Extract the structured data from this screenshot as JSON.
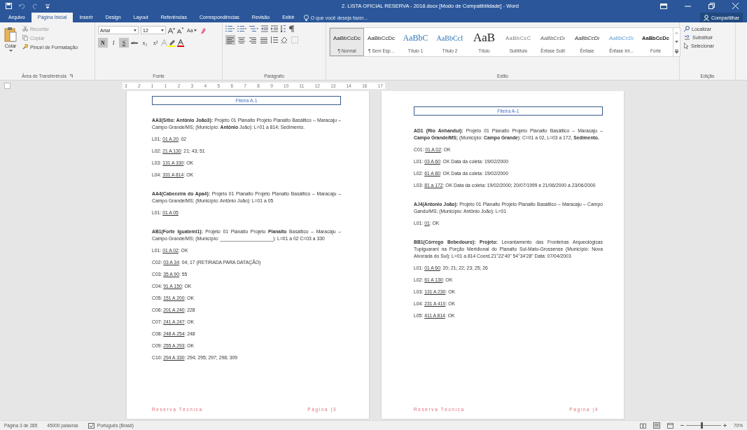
{
  "title_bar": {
    "title": "2. LISTA OFICIAL RESERVA - 2018.docx [Modo de Compatibilidade] - Word"
  },
  "tabs": [
    {
      "label": "Arquivo",
      "selected": false
    },
    {
      "label": "Página Inicial",
      "selected": true
    },
    {
      "label": "Inserir",
      "selected": false
    },
    {
      "label": "Design",
      "selected": false
    },
    {
      "label": "Layout",
      "selected": false
    },
    {
      "label": "Referências",
      "selected": false
    },
    {
      "label": "Correspondências",
      "selected": false
    },
    {
      "label": "Revisão",
      "selected": false
    },
    {
      "label": "Exibir",
      "selected": false
    }
  ],
  "tell_me": {
    "placeholder": "O que você deseja fazer..."
  },
  "share_button": "Compartilhar",
  "ribbon": {
    "clipboard": {
      "paste": "Colar",
      "cut": "Recortar",
      "copy": "Copiar",
      "format_painter": "Pincel de Formatação",
      "label": "Área de Transferência"
    },
    "font": {
      "font_name": "Arial",
      "font_size": "12",
      "change_case": "Aa",
      "format_buttons": [
        {
          "label": "N",
          "on": true
        },
        {
          "label": "I",
          "on": false
        },
        {
          "label": "S",
          "on": true
        },
        {
          "label": "abc",
          "on": false
        },
        {
          "label": "x₂",
          "on": false
        },
        {
          "label": "x²",
          "on": false
        }
      ],
      "label": "Fonte"
    },
    "paragraph": {
      "align_buttons": [
        {
          "selected": true
        },
        {
          "selected": false
        },
        {
          "selected": false
        },
        {
          "selected": false
        }
      ],
      "label": "Parágrafo"
    },
    "styles": {
      "items": [
        {
          "sample": "AaBbCcDc",
          "name": "¶ Normal",
          "kind": "normal",
          "selected": true
        },
        {
          "sample": "AaBbCcDc",
          "name": "¶ Sem Esp...",
          "kind": "normal",
          "selected": false
        },
        {
          "sample": "AaBbC",
          "name": "Título 1",
          "kind": "heading1",
          "selected": false
        },
        {
          "sample": "AaBbCcI",
          "name": "Título 2",
          "kind": "heading2",
          "selected": false
        },
        {
          "sample": "AaB",
          "name": "Título",
          "kind": "title",
          "selected": false
        },
        {
          "sample": "AaBbCcC",
          "name": "Subtítulo",
          "kind": "subtitle",
          "selected": false
        },
        {
          "sample": "AaBbCcDı",
          "name": "Ênfase Sutil",
          "kind": "subtle",
          "selected": false
        },
        {
          "sample": "AaBbCcDı",
          "name": "Ênfase",
          "kind": "emphasis",
          "selected": false
        },
        {
          "sample": "AaBbCcDı",
          "name": "Ênfase Int...",
          "kind": "intense",
          "selected": false
        },
        {
          "sample": "AaBbCcDc",
          "name": "Forte",
          "kind": "strong",
          "selected": false
        }
      ],
      "label": "Estilo"
    },
    "editing": {
      "find": "Localizar",
      "replace": "Substituir",
      "select": "Selecionar",
      "label": "Edição"
    }
  },
  "ruler": {
    "numbers": [
      "3",
      "2",
      "1",
      "1",
      "2",
      "3",
      "4",
      "5",
      "6",
      "7",
      "8",
      "9",
      "10",
      "11",
      "12",
      "13",
      "14",
      "16",
      "17"
    ]
  },
  "pages": [
    {
      "header": "Fileira A.1",
      "blocks": [
        {
          "kind": "heading",
          "text": "**AA3(Sítio: Antônio João3):** Projeto 01 Planalto Projeto Planalto Basáltico – Maracaju – Campo Grande/MS; (Município: **Antônio** João): L=01 a 814; Sedimento."
        },
        {
          "kind": "line",
          "label": "L01:",
          "range": "01 A 20",
          "rest": ": 02"
        },
        {
          "kind": "line",
          "label": "L02:",
          "range": "21 A 130",
          "rest": ": 21; 43; 51"
        },
        {
          "kind": "line",
          "label": "L03:",
          "range": "131 A 330",
          "rest": ": OK"
        },
        {
          "kind": "line",
          "label": "L04:",
          "range": "331 A 814",
          "rest": ": OK"
        },
        {
          "kind": "heading",
          "text": "**AA4(Cabeceira do Apa4):** Projeto 01 Planalto Projeto Planalto Basáltico – Maracaju – Campo Grande/MS; (Município: Antônio João): L=01 a 05"
        },
        {
          "kind": "line",
          "label": "L01:",
          "range": "01 A 05"
        },
        {
          "kind": "heading",
          "text": "**AB1(Forte Iguatemi1):** Projeto 01 Planalto Projeto **Planalto** Basáltico – Maracaju – Campo Grande/MS; (Município: ____________________): L=01 a 02 C=03 a 330"
        },
        {
          "kind": "line",
          "label": "L01:",
          "range": "01 A 02",
          "rest": ": OK"
        },
        {
          "kind": "line",
          "label": "C02:",
          "range": "03 A 34",
          "rest": ": 04; 17 (RETIRADA PARA DATAÇÃO)"
        },
        {
          "kind": "line",
          "label": "C03:",
          "range": "35 A 90",
          "rest": ": 55"
        },
        {
          "kind": "line",
          "label": "C04:",
          "range": "91 A 150",
          "rest": ": OK"
        },
        {
          "kind": "line",
          "label": "C05:",
          "range": "151 A 200",
          "rest": ": OK"
        },
        {
          "kind": "line",
          "label": "C06:",
          "range": "201 A 240",
          "rest": ": 228"
        },
        {
          "kind": "line",
          "label": "C07:",
          "range": "241 A 247",
          "rest": ": OK"
        },
        {
          "kind": "line",
          "label": "C08:",
          "range": "248 A 254",
          "rest": ": 248"
        },
        {
          "kind": "line",
          "label": "C09:",
          "range": "255 A 293",
          "rest": ": OK"
        },
        {
          "kind": "line",
          "label": "C10:",
          "range": "294 A 330",
          "rest": ": 294; 295; 297; 298; 309"
        }
      ],
      "footer_left": "Reserva Técnica",
      "footer_right": "Página |3"
    },
    {
      "header": "Fileira A-1",
      "blocks": [
        {
          "kind": "heading",
          "text": "**AD1 (Rio Anhanduí):** Projeto 01 Planalto Projeto Planalto Basáltico – Maracaju – **Campo Grande/MS;** (Município: **Campo Grande**): C=01 a 02, L=03 a 172, **Sedimento.**"
        },
        {
          "kind": "line",
          "label": "C01:",
          "range": "01 A 02",
          "rest": ": OK"
        },
        {
          "kind": "line",
          "label": "L01:",
          "range": "03 A 60",
          "rest": ": OK Data da coleta: 19/02/2000"
        },
        {
          "kind": "line",
          "label": "L02:",
          "range": "61 A 80",
          "rest": ": OK Data da coleta: 19/02/2000"
        },
        {
          "kind": "line",
          "label": "L03:",
          "range": "81 a 172",
          "rest": ": OK Data da coleta: 19/02/2000; 20/07/1999 e 21/06/2000 a 23/06/2000"
        },
        {
          "kind": "heading",
          "text": "**AJ4(Antonio João):** Projeto 01 Planalto Projeto Planalto Basáltico – Maracaju – Campo Gando/MS; (Município: Antônio João): L=01"
        },
        {
          "kind": "line",
          "label": "L01:",
          "range": "01",
          "rest": ": OK"
        },
        {
          "kind": "heading",
          "text": "**BB1(Córrego Bebedouro): Projeto:** Levantamento das Fronteiras Arqueológicas Tupiguarani na Porção Meridional do Planalto Sul-Mato-Grossense (Município: Nova Alvorada do Sul): L=01 a 814 Coord.21°22'40\" 54°34'28\" Data: 07/04/2003"
        },
        {
          "kind": "line",
          "label": "L01:",
          "range": "01 A 60",
          "rest": ": 20; 21; 22; 23; 25; 26"
        },
        {
          "kind": "line",
          "label": "L02:",
          "range": "61 A 130",
          "rest": ": OK"
        },
        {
          "kind": "line",
          "label": "L03:",
          "range": "131 A 230",
          "rest": ": OK"
        },
        {
          "kind": "line",
          "label": "L04:",
          "range": "231 A 410",
          "rest": ": OK"
        },
        {
          "kind": "line",
          "label": "L05:",
          "range": "411 A 814",
          "rest": ": OK"
        }
      ],
      "footer_left": "Reserva Técnica",
      "footer_right": "Página |4"
    }
  ],
  "status_bar": {
    "page": "Página 3 de 285",
    "words": "45000 palavras",
    "language": "Português (Brasil)",
    "zoom": {
      "level": 0.45
    },
    "zoom_text": "70%"
  }
}
